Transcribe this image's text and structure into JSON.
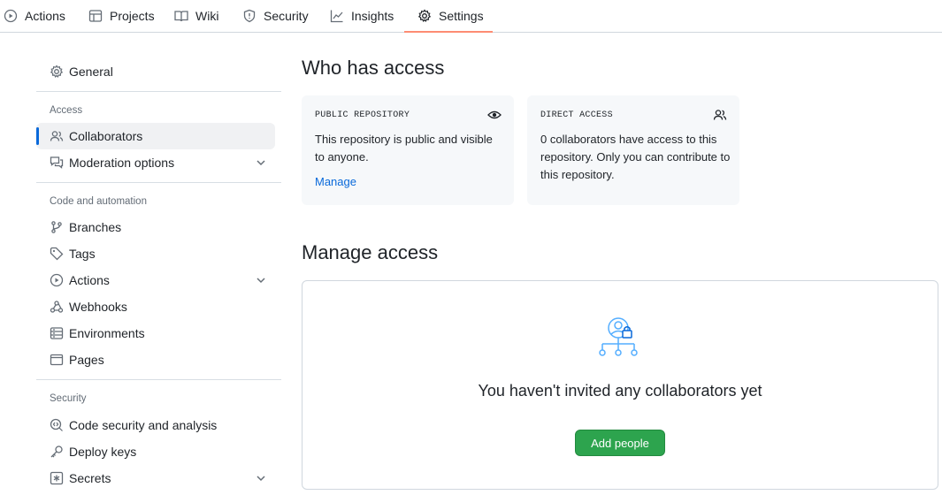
{
  "topnav": {
    "tabs": [
      {
        "label": "Actions",
        "icon": "play-icon"
      },
      {
        "label": "Projects",
        "icon": "table-icon"
      },
      {
        "label": "Wiki",
        "icon": "book-icon"
      },
      {
        "label": "Security",
        "icon": "shield-icon"
      },
      {
        "label": "Insights",
        "icon": "graph-icon"
      },
      {
        "label": "Settings",
        "icon": "gear-icon",
        "selected": true
      }
    ]
  },
  "sidebar": {
    "general": "General",
    "access_heading": "Access",
    "collaborators": "Collaborators",
    "moderation": "Moderation options",
    "code_heading": "Code and automation",
    "branches": "Branches",
    "tags": "Tags",
    "actions": "Actions",
    "webhooks": "Webhooks",
    "environments": "Environments",
    "pages": "Pages",
    "security_heading": "Security",
    "code_security": "Code security and analysis",
    "deploy_keys": "Deploy keys",
    "secrets": "Secrets"
  },
  "who_has_access": {
    "title": "Who has access",
    "public": {
      "label": "PUBLIC REPOSITORY",
      "text": "This repository is public and visible to anyone.",
      "link": "Manage"
    },
    "direct": {
      "label": "DIRECT ACCESS",
      "text": "0 collaborators have access to this repository. Only you can contribute to this repository."
    }
  },
  "manage_access": {
    "title": "Manage access",
    "empty_text": "You haven't invited any collaborators yet",
    "button": "Add people"
  },
  "colors": {
    "accent": "#0969da",
    "primary_button": "#2da44e",
    "selected_tab_underline": "#fd8c73",
    "illustration": "#54aeff"
  }
}
